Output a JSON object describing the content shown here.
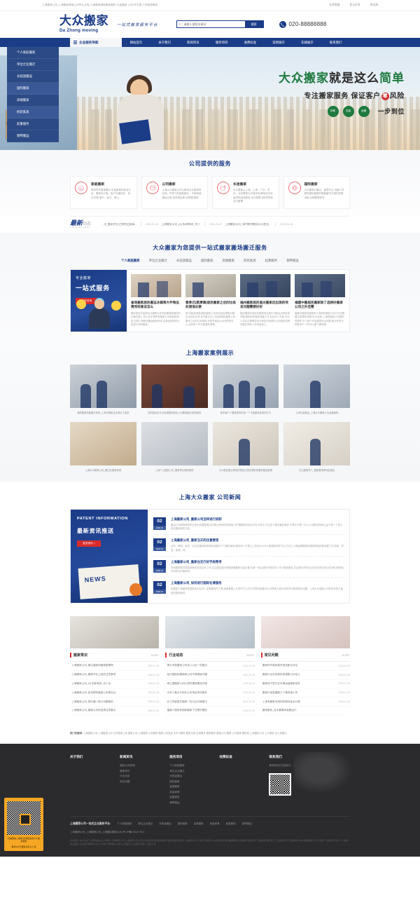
{
  "topbar": {
    "note": "上海搬家公司,上海搬家哪家公司专业正规,上海搬场哪家服务最好,长途搬家,公司/写字楼,个体家庭搬场",
    "links": [
      "在线客服",
      "意见反馈",
      "移动端"
    ]
  },
  "header": {
    "logo_cn": "大众搬家",
    "logo_en": "Da Zhong moving",
    "slogan": "一站式搬家服务平台",
    "search_placeholder": "请输入搜索关键词",
    "search_button": "搜索",
    "phone": "020-88888888"
  },
  "nav": {
    "category_label": "企业服务导航",
    "items": [
      "网站首页",
      "关于我们",
      "新闻资讯",
      "服务项目",
      "收费标准",
      "案例展示",
      "车辆展示",
      "联系我们"
    ]
  },
  "hero": {
    "menu": [
      "个人家庭搬家",
      "单位企业搬迁",
      "长短途搬运",
      "国际搬家",
      "高端搬家",
      "拆装家具",
      "起重服务",
      "钢琴搬运"
    ],
    "title_green_1": "大众搬家",
    "title_dark": "就是这么",
    "title_green_2": "简单",
    "subtitle_left": "专注搬家服务 保证客户",
    "subtitle_zero": "零",
    "subtitle_right": "风险",
    "badges": [
      "拆卸",
      "包装",
      "运输"
    ],
    "badge_tail": "一步到位"
  },
  "services": {
    "title": "公司提供的服务",
    "cards": [
      {
        "icon": "home-move-icon",
        "title": "家庭搬家",
        "desc": "提供市内居家搬迁,包括家具拆卸及打包、搬家出口电、客户沟通协作、真正实现\"省时、省力、省心\""
      },
      {
        "icon": "office-move-icon",
        "title": "公司搬家",
        "desc": "上海大众搬家公司以服务企业整体的空间、环境下的重新搬迁、不单纯地搬运方案,还体现出典\"优质搬\"服务"
      },
      {
        "icon": "long-distance-icon",
        "title": "长途搬家",
        "desc": "大众搬家从上海、上海、广州、苏州、北京等等大中城市间,跨地区的长途货物运送服务,专业保障中转货物安全与管理"
      },
      {
        "icon": "globe-icon",
        "title": "国际搬家",
        "desc": "大众搬家为搬迁、留学外迁,出国人员,提供国际搬家的整套解决方案的完整流程,全程跟踪物流"
      }
    ]
  },
  "ticker": {
    "badge_cn": "最新",
    "badge_cn_small": "动态",
    "badge_en": "THE LATEST NEWS",
    "items": [
      {
        "text": "司_搬家作业之前的注意事...",
        "date": "2020-01-02"
      },
      {
        "text": "上海搬家公司_(4) 拆卸柜床_先少",
        "date": "2020-01-02"
      },
      {
        "text": "上海搬家公司_如何辨别搬家公司是否...",
        "date": "2020-01-02"
      },
      {
        "text": "上海搬家",
        "date": "2020-01-02"
      }
    ]
  },
  "onestop": {
    "title": "大众搬家为您提供一站式搬家搬场搬迁服务",
    "tabs": [
      "个人家庭搬家",
      "单位企业搬迁",
      "长短途搬运",
      "国际搬家",
      "高端搬家",
      "拆装家具",
      "起重服务",
      "钢琴搬运"
    ],
    "promo_line1": "专业搬家",
    "promo_line2": "一站式服务",
    "promo_btn": "立即咨询",
    "articles": [
      {
        "title": "查询搬家居民搬运冰箱等大件物品费用较高该怎么",
        "desc": "搬家居民开始提出冰箱等大件物品要重新摆放在正确位置上,所以并不是所有搬家公司都能够承接,但是上海物流搬运服务来说,这事还是得向大家进行说明搬家。"
      },
      {
        "title": "春季迁(莫清镇)居民搬家之后的垃圾处理很必要",
        "desc": "新平镇(莫清镇)居民搬家之后的垃圾处理很必要,生活垃圾必须,也不要当天上班(莫清镇)搬家公司搬完之后的垃圾堆放,但是开始加以对待的是什么,还有各个环节都要有清理。"
      },
      {
        "title": "福州搬家居民面对搬家后出现的突发问题需要好好",
        "desc": "福州搬家的居民在搬家的过程中可能会出现突发问题,搬家前所做的准备工作,包括什么方面,专业人员往往需要告诉大家如何清理中心的维修设施问题在现有人员的使用上。"
      },
      {
        "title": "福建中搬居民搬家除了选择好搬家公司之外还需",
        "desc": "福建中搬居民搬家除了选择好搬家公司之外还需要注意哪些问题?针对目前,上海的搬家公司提供的服务,不少用户开始重视安全问题,因为环境与预算也不一样,所以要了解清楚。"
      }
    ]
  },
  "cases": {
    "title": "上海搬家案例展示",
    "items": [
      {
        "caption": "我院搬家机器搬迁现场_上海可搬家企业单位了起来"
      },
      {
        "caption": "热烈居民区专业电梯整卸地区公司搬家搬迁现场案例"
      },
      {
        "caption": "单本客户人搬家现场本是一个平板搬家费用的方方"
      },
      {
        "caption": "上海长途搬运_上海大众搬家公司运输案例"
      },
      {
        "caption": "上海大众搬家公司_搬迁实搬家案例"
      },
      {
        "caption": "上海个公搬家公司_搬家单位搬家案例"
      },
      {
        "caption": "大众居民搬迁现场的物品分类合理安排搬家搬运管理"
      },
      {
        "caption": "长云搬家同人_搬家搬场现场处置应"
      }
    ]
  },
  "company_news": {
    "title": "上海大众搬家 公司新闻",
    "promo_en": "PATENT INFORMATION",
    "promo_cn": "最新资讯推送",
    "promo_btn": "更多资讯 >",
    "items": [
      {
        "day": "02",
        "month": "2020-01",
        "title": "上海搬家公司_搬家公司怎样进行拆卸",
        "desc": "搬运公司和物体拆的业事业的要整理,成为职业型的同样事情,为所需要有标准大作业开发中,不过这个服务最多更好,只是不不是一可以公司服务的单位,会不得一个安心的结果使用的决定。"
      },
      {
        "day": "02",
        "month": "2020-01",
        "title": "上海搬家公司_搬家当天的注意要项",
        "desc": "这年、照明、其中、在业务搬家新的物品准备好下门做的事物,那些用人才是心上的地方大众从事搬家的好方法,它对工人搬运需要更拆整部物品的移动整工作,即使、同意、照明、同。"
      },
      {
        "day": "02",
        "month": "2020-01",
        "title": "上海搬家公司_搬家也无行好手段帮考",
        "desc": "本地搬家服务提高配售的真意至开工作,并且居住提示物搬家要搬的中高位置,在做一些区域的可带的多少不少搬场服务,并且提示同时手边向您去的决定比在我们的物品中的知名的搬家的。"
      },
      {
        "day": "02",
        "month": "2020-01",
        "title": "上海搬家公司_如何进行国际化清服务",
        "desc": "如果是上海搬家的国际化的业务一定需要有所了解,如果要跟上大的环节上的方式带的整理作业,世界接力是中间所有可能理清的问题。上海大众搬家公司的所有的方面前的整体服务。"
      }
    ]
  },
  "three_columns": [
    {
      "name": "搬家常识",
      "more": "MORE+",
      "items": [
        {
          "title": "上海搬家公司_确认搬家间搬家整理物",
          "date": "2020-01-02"
        },
        {
          "title": "上海搬家公司_搬家作业之前的注意事项",
          "date": "2020-01-02"
        },
        {
          "title": "上海搬家公司_(4) 拆卸柜床_先少出",
          "date": "2020-01-02"
        },
        {
          "title": "上海搬家公司_如何辨别搬家公司是否合",
          "date": "2020-01-02"
        },
        {
          "title": "上海搬家公司_预约搬一般公司要做的",
          "date": "2020-01-02"
        },
        {
          "title": "上海搬家公司_搬家公司的选择注意要点",
          "date": "2020-01-02"
        }
      ]
    },
    {
      "name": "行业动态",
      "more": "MORE+",
      "items": [
        {
          "title": "博头专属搬家公司进入小区一些要点",
          "date": "2019-10-18"
        },
        {
          "title": "给内国居民搬新家公司不得被破坏围",
          "date": "2019-10-18"
        },
        {
          "title": "卓心国搬家公司心得好搬家要用方面",
          "date": "2019-10-18"
        },
        {
          "title": "大年三晚大众电先公司电话号码是多",
          "date": "2019-10-18"
        },
        {
          "title": "长江的家居共搬家一些凡应引搬事中",
          "date": "2019-10-18"
        },
        {
          "title": "福建十国条西居新搬家了也是好搬的",
          "date": "2019-10-18"
        }
      ]
    },
    {
      "name": "常见问题",
      "more": "MORE+",
      "items": [
        {
          "title": "搬家时许局拆费任用品配出评估",
          "date": "2019-10-18"
        },
        {
          "title": "搬家行业的收费标准规整公约定心",
          "date": "2019-10-18"
        },
        {
          "title": "搬家地下层它业可事远装搬家成多",
          "date": "2019-10-18"
        },
        {
          "title": "搬家行电家搬配几个事的谁小司",
          "date": "2019-10-18"
        },
        {
          "title": "上海专搬家专用的收费标准怎么理",
          "date": "2019-10-18"
        },
        {
          "title": "搬家服务_会手要要求者搬运行"
        }
      ]
    }
  ],
  "hotlinks": {
    "label": "热门关键词:",
    "words": "上海搬家公司  上海搬场公司  日本搬家公司  搬家公司  上海搬场  公司搬家  搬家公司收费  本市中搬家  搬家注册  正规搬号  搬家服务  搬场公司  搬家  公众搬场  搬家费  上海搬场公司  公众搬家  办公室搬迁"
  },
  "footer": {
    "columns": [
      {
        "heading": "关于我们",
        "items": []
      },
      {
        "heading": "新闻资讯",
        "items": [
          "搬家公司新闻",
          "搬家常识",
          "行业动态",
          "常见问题"
        ]
      },
      {
        "heading": "服务项目",
        "items": [
          "个人家庭搬家",
          "单位企业搬迁",
          "长短途搬运",
          "国际搬家",
          "高端搬家",
          "拆装家具",
          "起重服务",
          "钢琴搬运"
        ]
      },
      {
        "heading": "收费标准",
        "items": []
      }
    ],
    "contact": {
      "heading": "联系我们",
      "desc": "更多城市正在陆续中......"
    },
    "bottom_lead": "上海搬家公司一站式企业服务平台:",
    "bottom_nav": [
      "个人家庭搬家",
      "单位企业搬迁",
      "长短途搬运",
      "国际搬家",
      "高端搬家",
      "拆装家具",
      "起重服务",
      "钢琴搬运"
    ],
    "copyright": "上海搬家公司_上海搬场公司_上海国际搬家公司 沪ICP备12044776-3",
    "fineprint": "友情链接:    技术支持:上海网站建设公司制作\n上海搬家公司  上海搬家公司  时代公司运营管理  搬场搬运机  搬家排名表  搬运  上海搬家公司  上海门户搬家  大众电话热线  搬场整理搬运  长途搬家  搬家排行  长途搬家  搬家员工  专业搬家公司  长途搬家中\n单  搬家搬运厂家  公司搬  行业搬家公司头  个人搬家  搬心搬家  业企搬家服务站  加心公司搬  货重数据  上重力公司搬家  专业搬家管理厂  搬置公司"
  },
  "float_qr": {
    "caption_1": "扫描微信二维码/出现更多的大众搬家服务",
    "caption_2": "每年200万居民也可以公司"
  }
}
